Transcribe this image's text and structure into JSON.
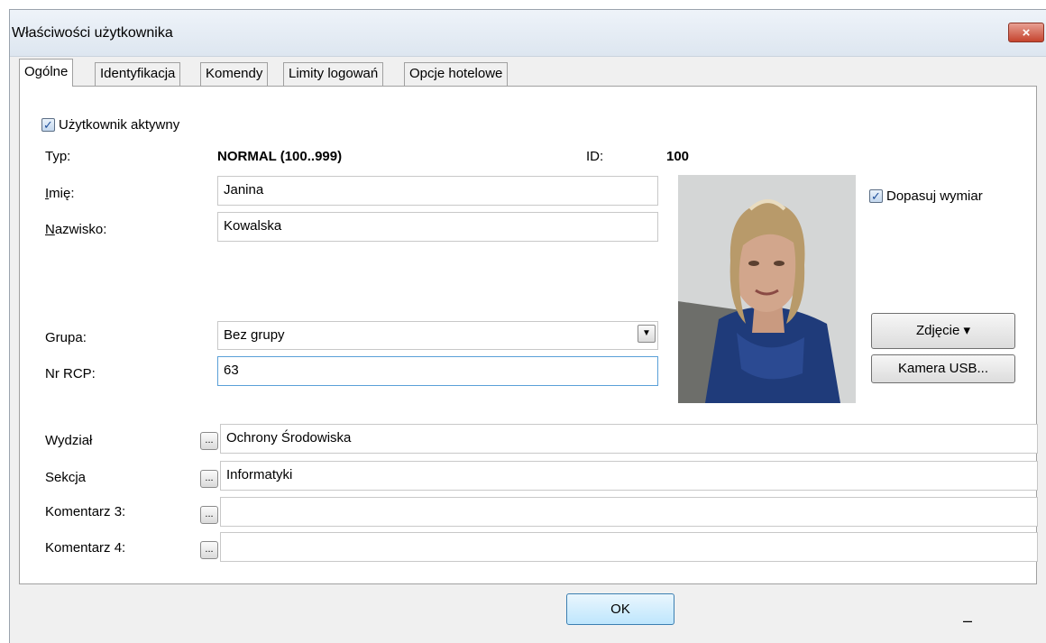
{
  "window": {
    "title": "Właściwości użytkownika",
    "close_label": "×"
  },
  "tabs": [
    {
      "label": "Ogólne",
      "active": true
    },
    {
      "label": "Identyfikacja"
    },
    {
      "label": "Komendy"
    },
    {
      "label": "Limity logowań"
    },
    {
      "label": "Opcje hotelowe"
    }
  ],
  "general": {
    "active_checkbox": {
      "label": "Użytkownik aktywny",
      "checked": true,
      "mark": "✓"
    },
    "type": {
      "label": "Typ:",
      "value": "NORMAL (100..999)"
    },
    "id": {
      "label": "ID:",
      "value": "100"
    },
    "first_name": {
      "label_u": "I",
      "label_rest": "mię:",
      "value": "Janina"
    },
    "last_name": {
      "label_u": "N",
      "label_rest": "azwisko:",
      "value": "Kowalska"
    },
    "group": {
      "label": "Grupa:",
      "value": "Bez grupy",
      "arrow": "▼"
    },
    "rcp": {
      "label": "Nr RCP:",
      "value": "63"
    },
    "fit_checkbox": {
      "label": "Dopasuj wymiar",
      "checked": true,
      "mark": "✓"
    },
    "photo_button": "Zdjęcie ▾",
    "camera_button": "Kamera USB...",
    "dots_label": "...",
    "extra_fields": [
      {
        "label": "Wydział",
        "value": "Ochrony Środowiska"
      },
      {
        "label": "Sekcja",
        "value": "Informatyki"
      },
      {
        "label": "Komentarz 3:",
        "value": ""
      },
      {
        "label": "Komentarz 4:",
        "value": ""
      }
    ]
  },
  "footer": {
    "ok_label": "OK",
    "dash": "–"
  }
}
